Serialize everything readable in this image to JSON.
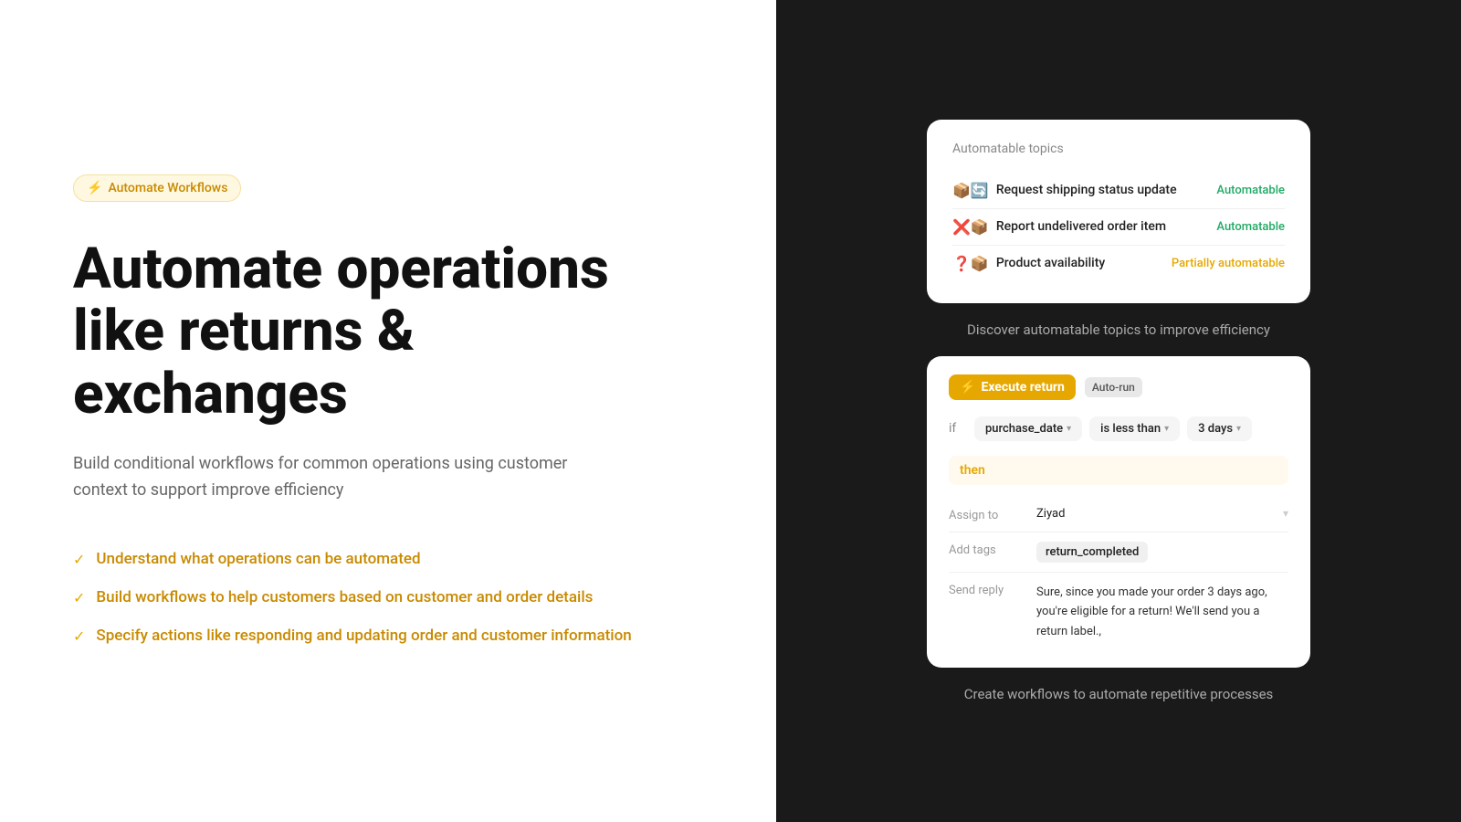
{
  "badge": {
    "icon": "⚡",
    "text": "Automate Workflows"
  },
  "heading": {
    "line1": "Automate operations",
    "line2": "like returns & exchanges"
  },
  "subtext": "Build conditional workflows for common operations using customer context to support improve efficiency",
  "checklist": [
    "Understand what operations can be automated",
    "Build workflows to help customers based on customer and order details",
    "Specify actions like responding and updating order and customer information"
  ],
  "topCard": {
    "title": "Automatable topics",
    "topics": [
      {
        "icons": "📦🔄",
        "name": "Request shipping status update",
        "status": "Automatable",
        "statusType": "automatable"
      },
      {
        "icons": "❌📦",
        "name": "Report undelivered order item",
        "status": "Automatable",
        "statusType": "automatable"
      },
      {
        "icons": "❓📦",
        "name": "Product availability",
        "status": "Partially automatable",
        "statusType": "partial"
      }
    ]
  },
  "topCaption": "Discover automatable topics to improve efficiency",
  "bottomCard": {
    "titleIcon": "⚡",
    "titleText": "Execute return",
    "autoBadge": "Auto-run",
    "conditionLabel": "if",
    "conditionField": "purchase_date",
    "conditionOp": "is less than",
    "conditionValue": "3 days",
    "thenLabel": "then",
    "actions": [
      {
        "label": "Assign to",
        "value": "Ziyad",
        "type": "dropdown"
      },
      {
        "label": "Add tags",
        "value": "return_completed",
        "type": "pill"
      },
      {
        "label": "Send reply",
        "value": "Sure, since you made your order 3 days ago, you're eligible for a return! We'll send you a return label.,",
        "type": "text"
      }
    ]
  },
  "bottomCaption": "Create workflows to automate repetitive processes"
}
